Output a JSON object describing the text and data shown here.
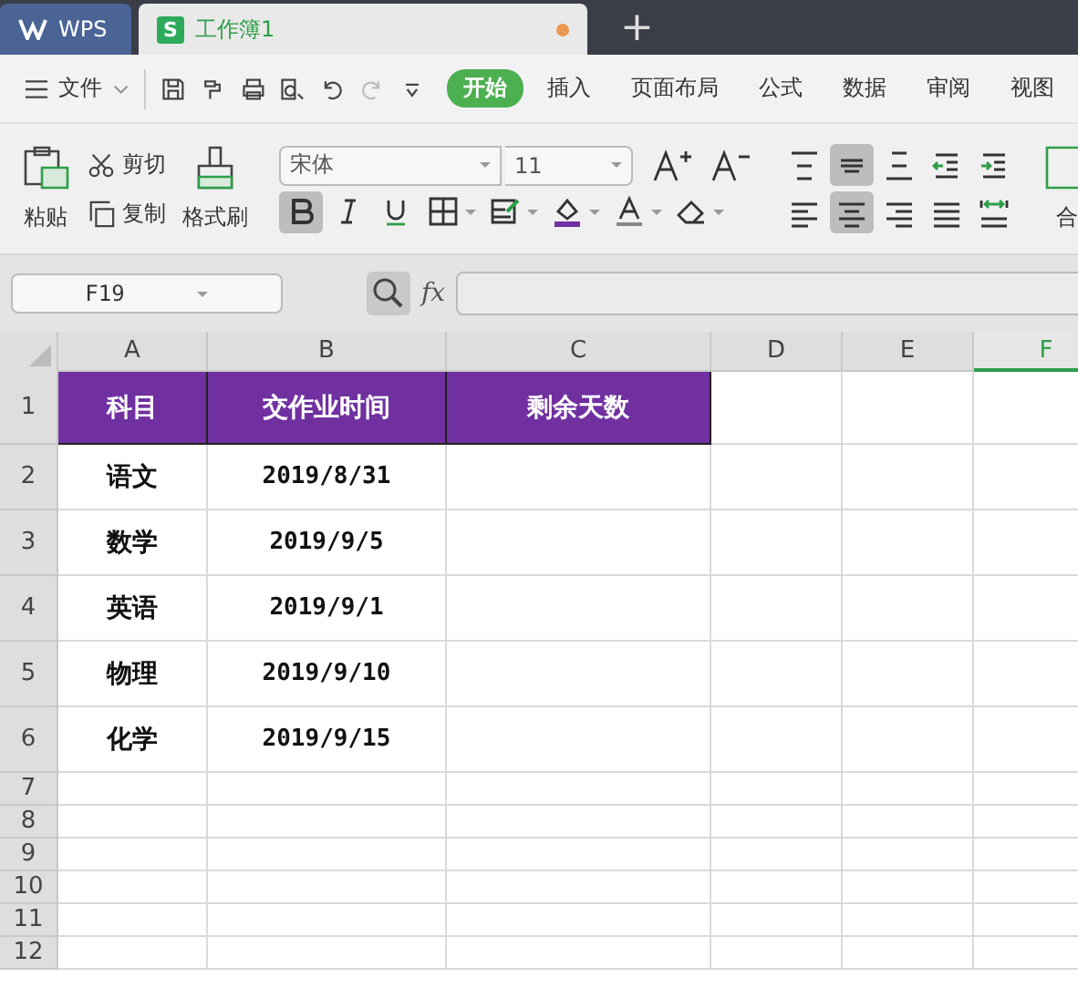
{
  "app_tabs": [
    {
      "kind": "home",
      "label": "WPS",
      "selected": false
    },
    {
      "kind": "sheet",
      "badge": "S",
      "label": "工作簿1",
      "selected": true,
      "unsaved": true
    }
  ],
  "new_tab": "+",
  "menu": {
    "file": "文件",
    "quick": [
      {
        "kind": "save",
        "disabled": false
      },
      {
        "kind": "format",
        "disabled": false
      },
      {
        "kind": "print",
        "disabled": false
      },
      {
        "kind": "preview",
        "disabled": false
      },
      {
        "kind": "undo",
        "disabled": false
      },
      {
        "kind": "redo",
        "disabled": true
      },
      {
        "kind": "more",
        "disabled": false
      }
    ],
    "tabs": [
      {
        "label": "开始",
        "selected": true
      },
      {
        "label": "插入",
        "selected": false
      },
      {
        "label": "页面布局",
        "selected": false
      },
      {
        "label": "公式",
        "selected": false
      },
      {
        "label": "数据",
        "selected": false
      },
      {
        "label": "审阅",
        "selected": false
      },
      {
        "label": "视图",
        "selected": false
      }
    ]
  },
  "ribbon": {
    "paste": "粘贴",
    "cut": "剪切",
    "copy": "复制",
    "format_painter": "格式刷",
    "font": "宋体",
    "size": "11",
    "font_tools": [
      {
        "kind": "bold",
        "selected": true
      },
      {
        "kind": "italic",
        "selected": false
      },
      {
        "kind": "underline",
        "selected": false
      },
      {
        "kind": "border",
        "selected": false
      },
      {
        "kind": "cellstyle",
        "selected": false
      },
      {
        "kind": "fill",
        "selected": false
      },
      {
        "kind": "fontcolor",
        "selected": false
      },
      {
        "kind": "eraser",
        "selected": false
      }
    ],
    "align_top": [
      {
        "kind": "top",
        "selected": false
      },
      {
        "kind": "middle",
        "selected": true
      },
      {
        "kind": "bottom",
        "selected": false
      },
      {
        "kind": "outdent",
        "selected": false
      },
      {
        "kind": "indent",
        "selected": false
      }
    ],
    "align_bottom": [
      {
        "kind": "left",
        "selected": false
      },
      {
        "kind": "center",
        "selected": true
      },
      {
        "kind": "right",
        "selected": false
      },
      {
        "kind": "justify",
        "selected": false
      },
      {
        "kind": "distribute",
        "selected": false
      }
    ],
    "merge": "合"
  },
  "formula_bar": {
    "cell": "F19",
    "fx": "fx"
  },
  "columns": [
    {
      "label": "A",
      "selected": false
    },
    {
      "label": "B",
      "selected": false
    },
    {
      "label": "C",
      "selected": false
    },
    {
      "label": "D",
      "selected": false
    },
    {
      "label": "E",
      "selected": false
    },
    {
      "label": "F",
      "selected": true
    }
  ],
  "rows": [
    {
      "label": "1",
      "kind": "header",
      "cells": [
        "科目",
        "交作业时间",
        "剩余天数"
      ]
    },
    {
      "label": "2",
      "kind": "data",
      "cells": [
        "语文",
        "2019/8/31"
      ]
    },
    {
      "label": "3",
      "kind": "data",
      "cells": [
        "数学",
        "2019/9/5"
      ]
    },
    {
      "label": "4",
      "kind": "data",
      "cells": [
        "英语",
        "2019/9/1"
      ]
    },
    {
      "label": "5",
      "kind": "data",
      "cells": [
        "物理",
        "2019/9/10"
      ]
    },
    {
      "label": "6",
      "kind": "data",
      "cells": [
        "化学",
        "2019/9/15"
      ]
    },
    {
      "label": "7",
      "kind": "empty"
    },
    {
      "label": "8",
      "kind": "empty"
    },
    {
      "label": "9",
      "kind": "empty"
    },
    {
      "label": "10",
      "kind": "empty"
    },
    {
      "label": "11",
      "kind": "empty"
    },
    {
      "label": "12",
      "kind": "empty"
    }
  ]
}
